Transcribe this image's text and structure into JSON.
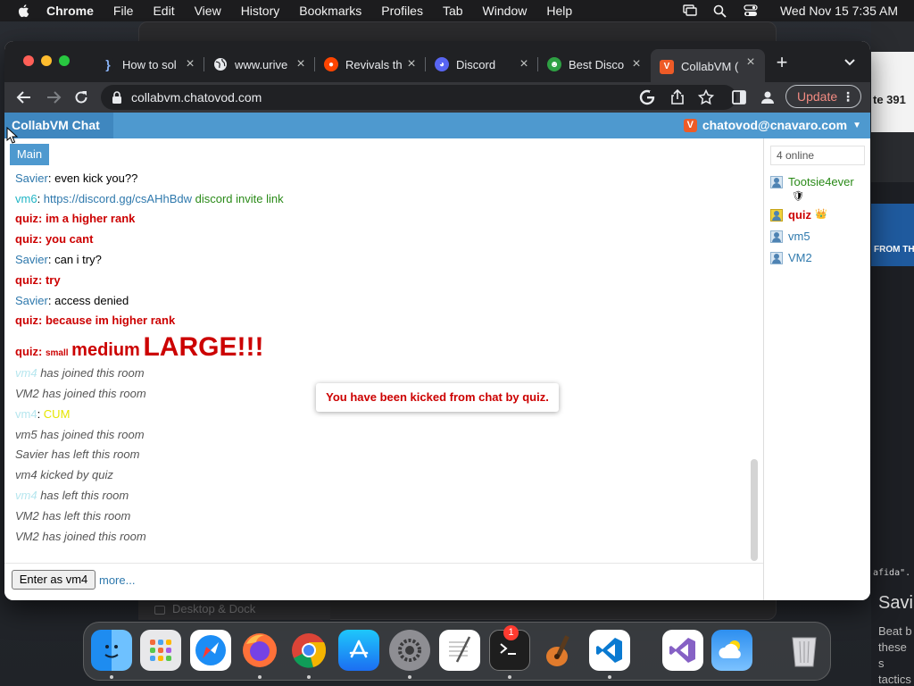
{
  "menubar": {
    "app_name": "Chrome",
    "items": [
      "File",
      "Edit",
      "View",
      "History",
      "Bookmarks",
      "Profiles",
      "Tab",
      "Window",
      "Help"
    ],
    "clock": "Wed Nov 15  7:35 AM",
    "status_icons": [
      "screen-mirror-icon",
      "search-icon",
      "control-center-icon"
    ]
  },
  "background": {
    "dock_item_label": "Desktop & Dock",
    "right_panel_number": "te 391",
    "right_panel_from": "FROM TH",
    "right_panel_code": "afida\".",
    "right_panel_heading": "Savi",
    "right_panel_body": [
      "Beat b",
      "these s",
      "tactics"
    ]
  },
  "browser": {
    "tabs": [
      {
        "title": "How to sol",
        "icon": "bracket-icon"
      },
      {
        "title": "www.urive",
        "icon": "globe-icon"
      },
      {
        "title": "Revivals th",
        "icon": "reddit-icon"
      },
      {
        "title": "Discord",
        "icon": "discord-icon"
      },
      {
        "title": "Best Disco",
        "icon": "bot-icon"
      },
      {
        "title": "CollabVM (",
        "icon": "collabvm-icon",
        "active": true
      }
    ],
    "url": "collabvm.chatovod.com",
    "update_label": "Update"
  },
  "page": {
    "room_menu": "CollabVM Chat",
    "user_menu": "chatovod@cnavaro.com",
    "main_tab": "Main",
    "online_count": "4 online",
    "enter_button": "Enter as vm4",
    "more_link": "more...",
    "kick_popup": "You have been kicked from chat by quiz.",
    "messages": [
      {
        "nick": "Savier",
        "text": "even kick you??"
      },
      {
        "nick": "vm6",
        "link": "https://discord.gg/csAHhBdw",
        "text": " discord invite link"
      },
      {
        "nick": "quiz",
        "text": "im a higher rank"
      },
      {
        "nick": "quiz",
        "text": "you cant"
      },
      {
        "nick": "Savier",
        "text": "can i try?"
      },
      {
        "nick": "quiz",
        "text": "try"
      },
      {
        "nick": "Savier",
        "text": "access denied"
      },
      {
        "nick": "quiz",
        "text": "because im higher rank"
      },
      {
        "nick": "quiz",
        "small": "small",
        "medium": "medium",
        "large": "LARGE!!!"
      },
      {
        "nick": "vm4",
        "text": "has joined this room"
      },
      {
        "nick": "VM2",
        "text": "has joined this room"
      },
      {
        "nick": "vm4",
        "text": "CUM"
      },
      {
        "nick": "vm5",
        "text": "has joined this room"
      },
      {
        "nick": "Savier",
        "text": "has left this room"
      },
      {
        "nick": "vm4",
        "text": "kicked by quiz"
      },
      {
        "nick": "vm4",
        "text": "has left this room"
      },
      {
        "nick": "VM2",
        "text": "has left this room"
      },
      {
        "nick": "VM2",
        "text": "has joined this room"
      }
    ],
    "users": [
      {
        "name": "Tootsie4ever",
        "badge": "shield-icon"
      },
      {
        "name": "quiz",
        "badge": "crown-icon"
      },
      {
        "name": "vm5"
      },
      {
        "name": "VM2"
      }
    ]
  },
  "dock": {
    "apps": [
      "Finder",
      "Launchpad",
      "Safari",
      "Firefox",
      "Chrome",
      "App Store",
      "System Settings",
      "TextEdit",
      "Terminal",
      "GarageBand",
      "Visual Studio Code",
      "Visual Studio",
      "Weather",
      "Trash"
    ],
    "settings_badge": "1"
  }
}
